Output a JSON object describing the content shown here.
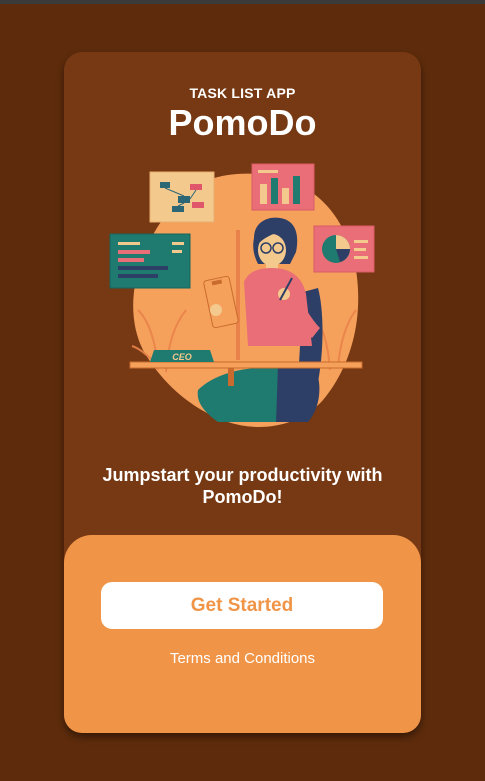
{
  "app": {
    "subtitle": "TASK LIST APP",
    "title": "PomoDo"
  },
  "illustration": {
    "icon": "woman-with-clipboard-and-charts-illustration",
    "desk_sign": "CEO"
  },
  "tagline": "Jumpstart your productivity with PomoDo!",
  "actions": {
    "primary_label": "Get Started",
    "terms_label": "Terms and Conditions"
  },
  "colors": {
    "background": "#5e2c0c",
    "card": "#773913",
    "accent": "#f09548",
    "button": "#ffffff"
  }
}
